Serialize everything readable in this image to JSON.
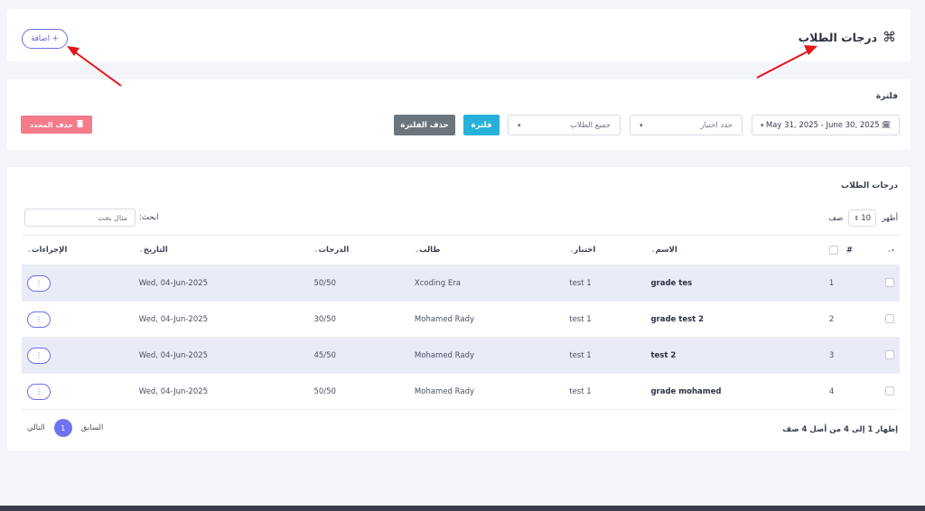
{
  "header": {
    "title": "درجات الطلاب",
    "title_icon": "command-icon",
    "add_button": "+ اضافة"
  },
  "filter": {
    "label": "فلترة",
    "date_range": "May 31, 2025 - June 30, 2025",
    "exam_select": "حدد اختبار",
    "student_select": "جميع الطلاب",
    "filter_button": "فلترة",
    "clear_button": "حذف الفلترة",
    "delete_selected_button": "حذف المحدد"
  },
  "table_card": {
    "title": "درجات الطلاب",
    "show_prefix": "أظهر",
    "page_length": "10",
    "show_suffix": "صف",
    "search_label": "ابحث:",
    "search_placeholder": "مثال بحث",
    "columns": {
      "number": "#",
      "name": "الاسم",
      "exam": "اختبار",
      "student": "طالب",
      "grade": "الدرجات",
      "date": "التاريخ",
      "actions": "الإجراءات"
    },
    "rows": [
      {
        "num": "1",
        "name": "grade tes",
        "exam": "test 1",
        "student": "Xcoding Era",
        "grade": "50/50",
        "date": "Wed, 04-Jun-2025"
      },
      {
        "num": "2",
        "name": "grade test 2",
        "exam": "test 1",
        "student": "Mohamed Rady",
        "grade": "30/50",
        "date": "Wed, 04-Jun-2025"
      },
      {
        "num": "3",
        "name": "test 2",
        "exam": "test 1",
        "student": "Mohamed Rady",
        "grade": "45/50",
        "date": "Wed, 04-Jun-2025"
      },
      {
        "num": "4",
        "name": "grade mohamed",
        "exam": "test 1",
        "student": "Mohamed Rady",
        "grade": "50/50",
        "date": "Wed, 04-Jun-2025"
      }
    ],
    "info": "إظهار 1 إلى 4 من أصل 4 صف",
    "pagination": {
      "previous": "السابق",
      "current": "1",
      "next": "التالي"
    }
  },
  "colors": {
    "primary": "#6f73f0",
    "info": "#27b1da",
    "danger": "#f47b8a",
    "secondary": "#6c757d",
    "annotation_arrow": "#e3161b"
  }
}
